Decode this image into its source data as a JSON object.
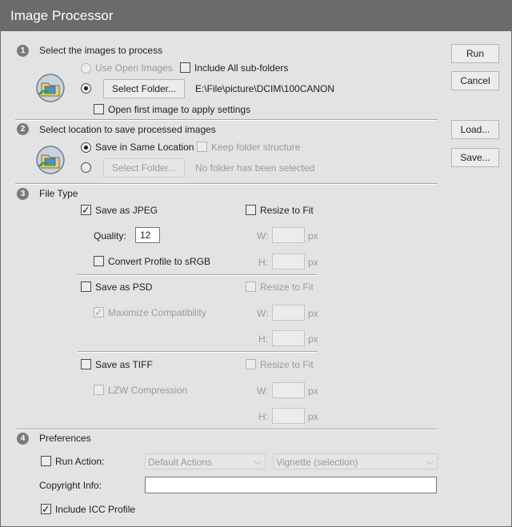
{
  "title": "Image Processor",
  "buttons": {
    "run": "Run",
    "cancel": "Cancel",
    "load": "Load...",
    "save": "Save..."
  },
  "section1": {
    "number": "1",
    "heading": "Select the images to process",
    "use_open": "Use Open Images",
    "include_sub": "Include All sub-folders",
    "select_folder": "Select Folder...",
    "path": "E:\\File\\picture\\DCIM\\100CANON",
    "open_first": "Open first image to apply settings",
    "icon": "photo-folder-icon"
  },
  "section2": {
    "number": "2",
    "heading": "Select location to save processed images",
    "same_location": "Save in Same Location",
    "keep_structure": "Keep folder structure",
    "select_folder": "Select Folder...",
    "no_folder": "No folder has been selected",
    "icon": "photo-folder-icon"
  },
  "section3": {
    "number": "3",
    "heading": "File Type",
    "jpeg": {
      "label": "Save as JPEG",
      "checked": true,
      "resize": "Resize to Fit",
      "quality_label": "Quality:",
      "quality_value": "12",
      "convert": "Convert Profile to sRGB"
    },
    "psd": {
      "label": "Save as PSD",
      "resize": "Resize to Fit",
      "maximize": "Maximize Compatibility"
    },
    "tiff": {
      "label": "Save as TIFF",
      "resize": "Resize to Fit",
      "lzw": "LZW Compression"
    },
    "w_label": "W:",
    "h_label": "H:",
    "unit": "px"
  },
  "section4": {
    "number": "4",
    "heading": "Preferences",
    "run_action": "Run Action:",
    "action_set": "Default Actions",
    "action": "Vignette (selection)",
    "copyright_label": "Copyright Info:",
    "copyright_value": "",
    "include_icc": "Include ICC Profile",
    "include_icc_checked": true
  }
}
